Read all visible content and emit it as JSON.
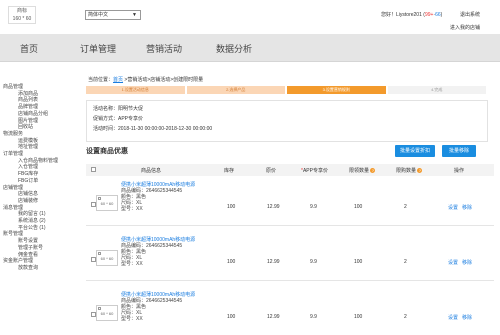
{
  "header": {
    "logo": [
      "商标",
      "160 * 60"
    ],
    "language": "简体中文",
    "user": {
      "prefix": "您好！",
      "name": "Liystore201",
      "count1": "99+",
      "count2": "66"
    },
    "logout": "退出系统",
    "enter_shop": "进入我的店铺"
  },
  "nav": [
    "首页",
    "订单管理",
    "营销活动",
    "数据分析"
  ],
  "sidebar": [
    {
      "group": "商品管理",
      "items": [
        "添加商品",
        "商品列表",
        "品牌管理",
        "店铺商品分组",
        "图片管理",
        "回收站"
      ]
    },
    {
      "group": "物流服务",
      "items": [
        "运费模板",
        "地址管理"
      ]
    },
    {
      "group": "订单管理",
      "items": [
        "入仓商品物料管理",
        "入仓管理",
        "FBG库存",
        "FBG订单"
      ]
    },
    {
      "group": "店铺管理",
      "items": [
        "店铺信息",
        "店铺装修"
      ]
    },
    {
      "group": "消息管理",
      "items": [
        "我的留言 (1)",
        "系统消息 (2)",
        "平台公告 (1)"
      ]
    },
    {
      "group": "账号管理",
      "items": [
        "账号设置",
        "管理子账号",
        "佣金查看"
      ]
    },
    {
      "group": "资金账户管理",
      "items": [
        "放款查询"
      ]
    }
  ],
  "breadcrumb": {
    "prefix": "当前位置：",
    "home": "首页",
    "path": " >营销活动>店铺活动>创建限时限量"
  },
  "steps": [
    "1.设置活动信息",
    "2.选择产品",
    "3.设置营销规则",
    "4.完成"
  ],
  "activity": {
    "name": "活动名称：阳明节大促",
    "method": "促销方式：APP专享价",
    "time": "活动时间：2018-11-30 00:00:00-2018-12-30 00:00:00"
  },
  "section_title": "设置商品优惠",
  "buttons": {
    "batch_set": "批量设置折扣",
    "batch_remove": "批量移除"
  },
  "columns": [
    "商品信息",
    "库存",
    "原价",
    "APP专享价",
    "限领数量",
    "限购数量",
    "操作"
  ],
  "products": [
    {
      "thumb": "60 * 60",
      "name": [
        "便携小米超薄10000mAh移动电源",
        "商品编码：2646625344545",
        "颜色：黑色",
        "尺码：XL",
        "型号：XX"
      ],
      "stock": "100",
      "price": "12.99",
      "app_price": "9.9",
      "limit_claim": "100",
      "limit_buy": "2",
      "actions": [
        "设置",
        "移除"
      ]
    },
    {
      "thumb": "60 * 60",
      "name": [
        "便携小米超薄10000mAh移动电源",
        "商品编码：2646625344545",
        "颜色：黑色",
        "尺码：XL",
        "型号：XX"
      ],
      "stock": "100",
      "price": "12.99",
      "app_price": "9.9",
      "limit_claim": "100",
      "limit_buy": "2",
      "actions": [
        "设置",
        "移除"
      ]
    },
    {
      "thumb": "60 * 60",
      "name": [
        "便携小米超薄10000mAh移动电源",
        "商品编码：2646625344545",
        "颜色：黑色",
        "尺码：XL",
        "型号：XX"
      ],
      "stock": "100",
      "price": "12.99",
      "app_price": "9.9",
      "limit_claim": "100",
      "limit_buy": "2",
      "actions": [
        "设置",
        "移除"
      ]
    }
  ]
}
